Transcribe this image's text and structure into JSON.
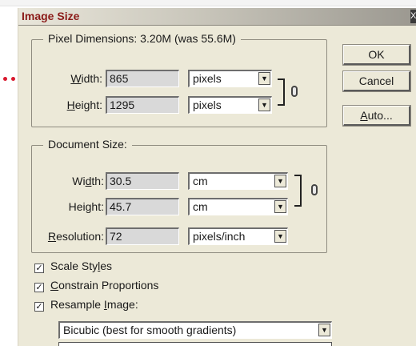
{
  "dialog": {
    "title": "Image Size",
    "close_label": "X"
  },
  "pixel_dimensions": {
    "legend": "Pixel Dimensions:  3.20M (was 55.6M)",
    "width": {
      "label_mnemonic": "W",
      "label_rest": "idth:",
      "value": "865",
      "unit": "pixels"
    },
    "height": {
      "label_mnemonic": "H",
      "label_rest": "eight:",
      "value": "1295",
      "unit": "pixels"
    }
  },
  "document_size": {
    "legend": "Document Size:",
    "width": {
      "label_pre": "Wi",
      "label_mnemonic": "d",
      "label_rest": "th:",
      "value": "30.5",
      "unit": "cm"
    },
    "height": {
      "label_pre": "Hei",
      "label_mnemonic": "g",
      "label_rest": "ht:",
      "value": "45.7",
      "unit": "cm"
    },
    "resolution": {
      "label_mnemonic": "R",
      "label_rest": "esolution:",
      "value": "72",
      "unit": "pixels/inch"
    }
  },
  "buttons": {
    "ok": "OK",
    "cancel": "Cancel",
    "auto_mnemonic": "A",
    "auto_rest": "uto..."
  },
  "options": {
    "scale_styles": {
      "pre": "Scale Sty",
      "mnemonic": "l",
      "rest": "es",
      "checked": true
    },
    "constrain": {
      "pre": "",
      "mnemonic": "C",
      "rest": "onstrain Proportions",
      "checked": true
    },
    "resample": {
      "pre": "Resample ",
      "mnemonic": "I",
      "rest": "mage:",
      "checked": true
    },
    "check_mark": "✓"
  },
  "resample_method": "Bicubic (best for smooth gradients)",
  "icons": {
    "chain": "link-chain-icon",
    "dropdown": "chevron-down-icon"
  },
  "colors": {
    "title_text": "#8b1a18",
    "dialog_bg": "#ece9d8",
    "annotation_red": "#d9182d"
  }
}
